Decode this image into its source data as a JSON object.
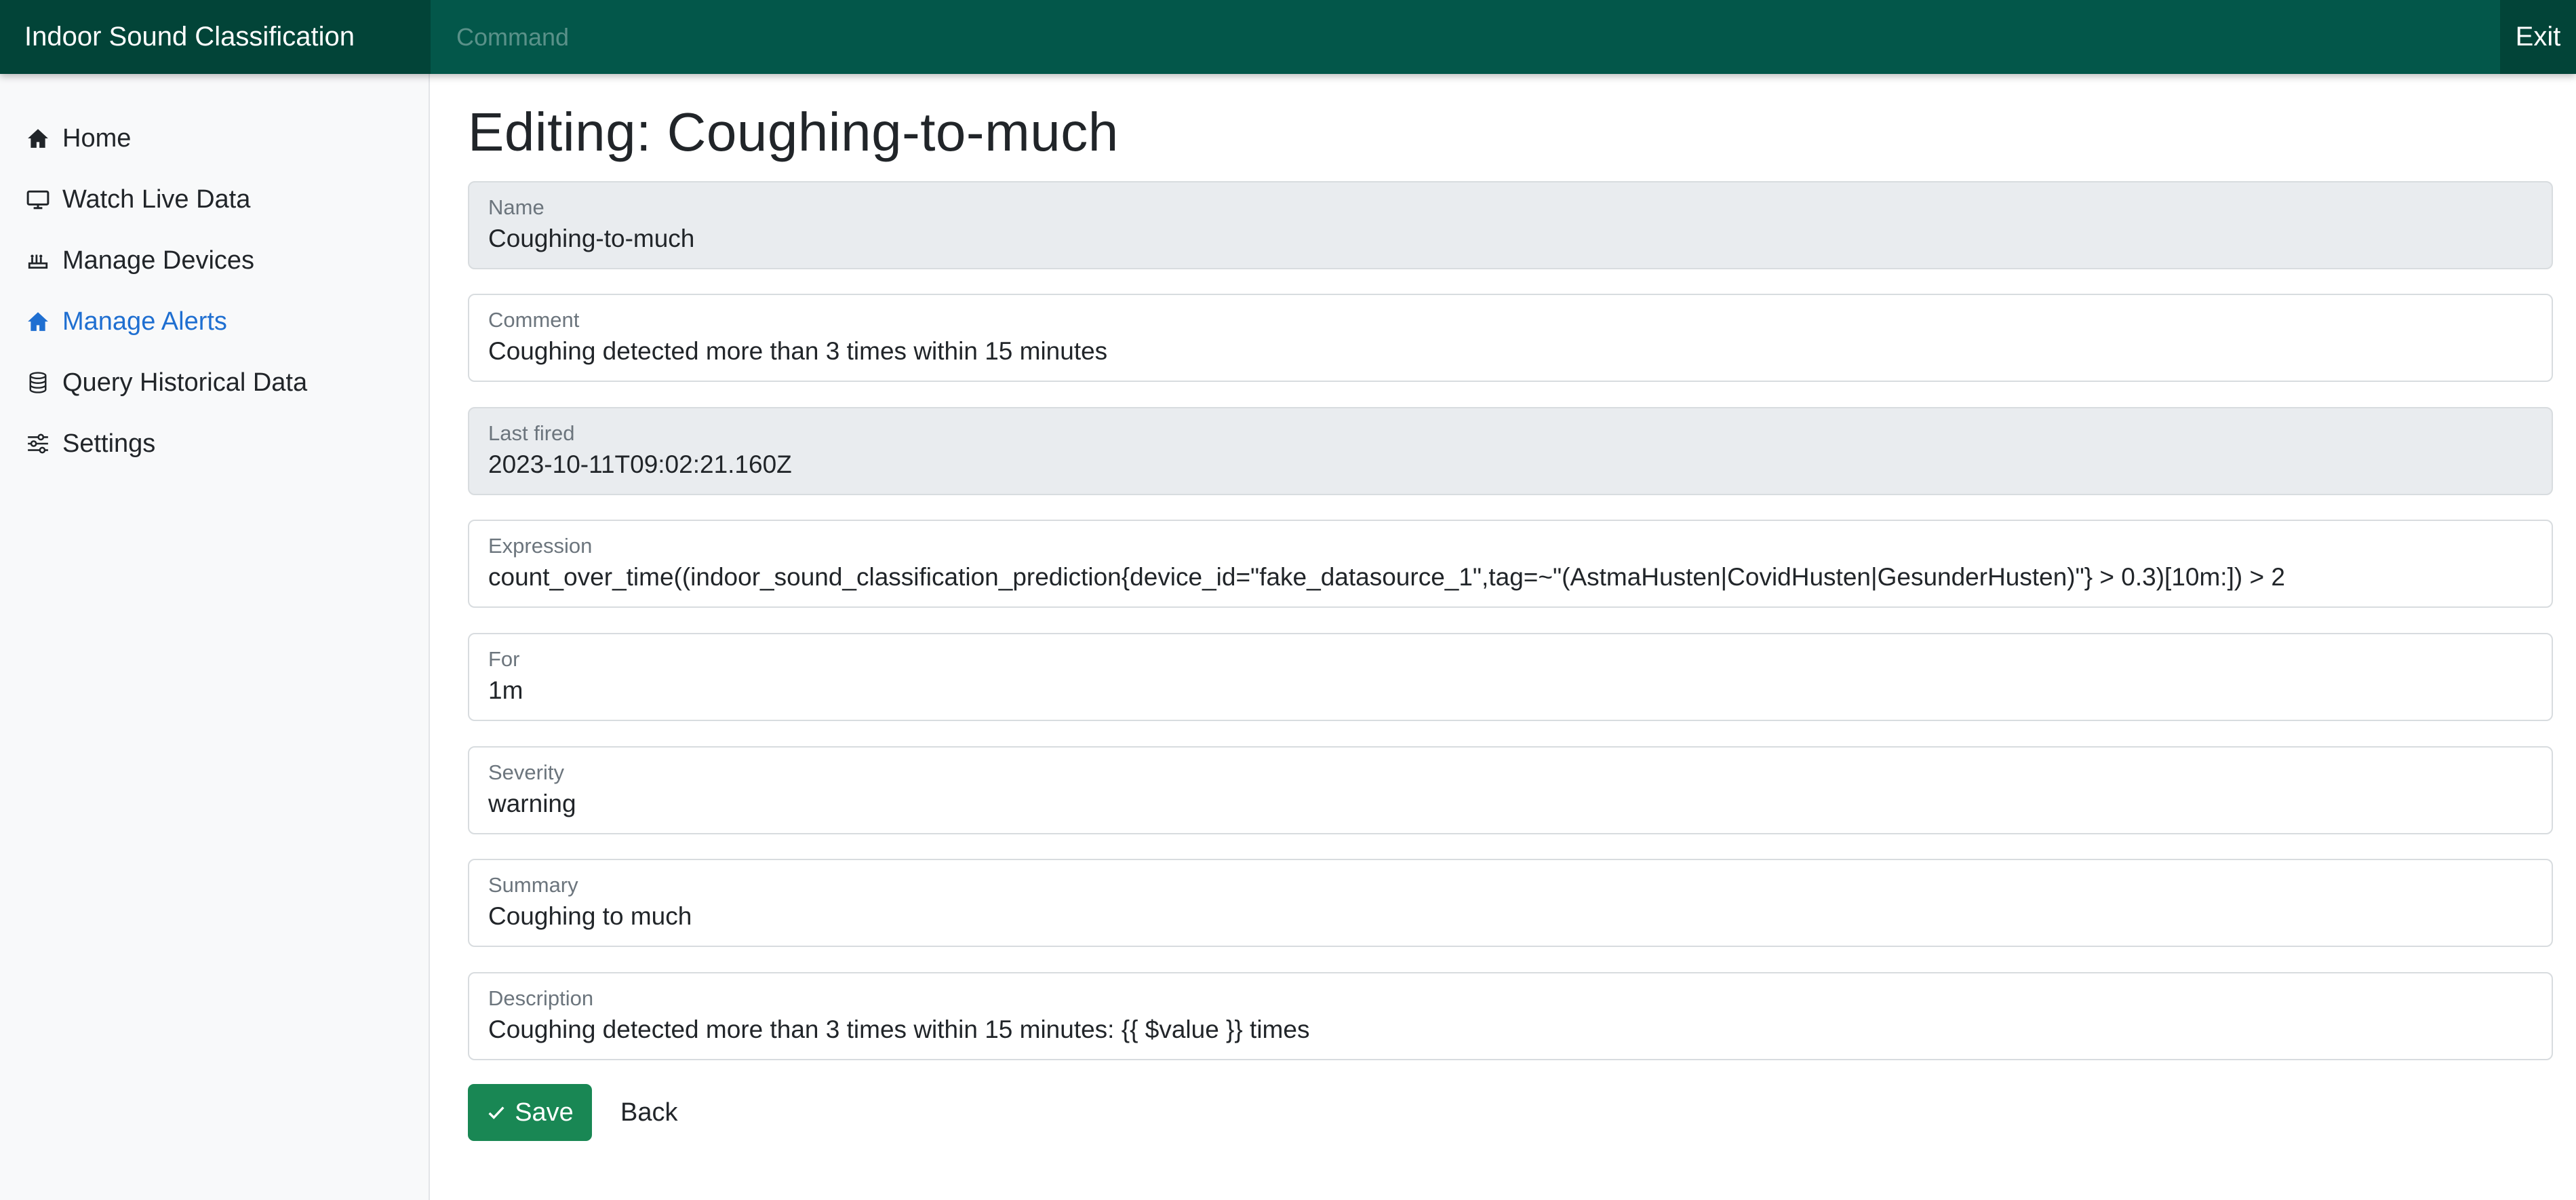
{
  "app": {
    "brand": "Indoor Sound Classification",
    "command_placeholder": "Command",
    "exit_label": "Exit"
  },
  "sidebar": {
    "items": [
      {
        "label": "Home",
        "icon": "home-icon",
        "active": false
      },
      {
        "label": "Watch Live Data",
        "icon": "monitor-icon",
        "active": false
      },
      {
        "label": "Manage Devices",
        "icon": "devices-icon",
        "active": false
      },
      {
        "label": "Manage Alerts",
        "icon": "alerts-home-icon",
        "active": true
      },
      {
        "label": "Query Historical Data",
        "icon": "database-icon",
        "active": false
      },
      {
        "label": "Settings",
        "icon": "sliders-icon",
        "active": false
      }
    ]
  },
  "page": {
    "title": "Editing: Coughing-to-much"
  },
  "form": {
    "fields": [
      {
        "label": "Name",
        "value": "Coughing-to-much",
        "readonly": true
      },
      {
        "label": "Comment",
        "value": "Coughing detected more than 3 times within 15 minutes",
        "readonly": false
      },
      {
        "label": "Last fired",
        "value": "2023-10-11T09:02:21.160Z",
        "readonly": true
      },
      {
        "label": "Expression",
        "value": "count_over_time((indoor_sound_classification_prediction{device_id=\"fake_datasource_1\",tag=~\"(AstmaHusten|CovidHusten|GesunderHusten)\"} > 0.3)[10m:]) > 2",
        "readonly": false
      },
      {
        "label": "For",
        "value": "1m",
        "readonly": false
      },
      {
        "label": "Severity",
        "value": "warning",
        "readonly": false
      },
      {
        "label": "Summary",
        "value": "Coughing to much",
        "readonly": false
      },
      {
        "label": "Description",
        "value": "Coughing detected more than 3 times within 15 minutes: {{ $value }} times",
        "readonly": false
      }
    ],
    "save_label": "Save",
    "back_label": "Back"
  },
  "colors": {
    "navbar": "#03574a",
    "brand_bg": "#024438",
    "active_link": "#1f6fd1",
    "save_button": "#198754"
  }
}
